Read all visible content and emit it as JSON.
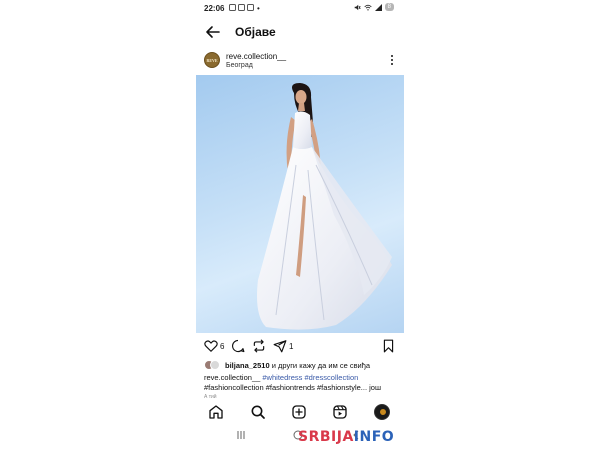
{
  "status_bar": {
    "time": "22:06",
    "dot": "•",
    "battery": "8"
  },
  "header": {
    "title": "Објаве"
  },
  "post": {
    "username": "reve.collection__",
    "location": "Београд",
    "avatar_text": "REVE",
    "likes_count": "6",
    "shares_count": "1",
    "liked_by_user": "biljana_2510",
    "liked_by_rest": " и други кажу да им се свиђа",
    "caption_user": "reve.collection__",
    "hashtags_line1": [
      "#whitedress",
      "#dresscollection"
    ],
    "hashtags_line2": [
      "#fashioncollection",
      "#fashiontrends",
      "#fashionstyle..."
    ],
    "more_label": "још",
    "cutoff_text": "А тий"
  },
  "colors": {
    "hashtag": "#3a5aa8",
    "photo_background": "#c6e0f7",
    "dress": "#f2f2f6",
    "watermark_red": "#d9394a",
    "watermark_blue": "#2b62b8"
  },
  "icons": {
    "back": "back-arrow-icon",
    "more": "more-vertical-icon",
    "like": "heart-icon",
    "comment": "comment-icon",
    "repost": "repost-icon",
    "share": "share-icon",
    "save": "bookmark-icon",
    "home": "home-icon",
    "search": "search-icon",
    "create": "create-post-icon",
    "reels": "reels-icon"
  },
  "watermark": {
    "part1": "SRBIJA",
    "part2": "INFO"
  }
}
